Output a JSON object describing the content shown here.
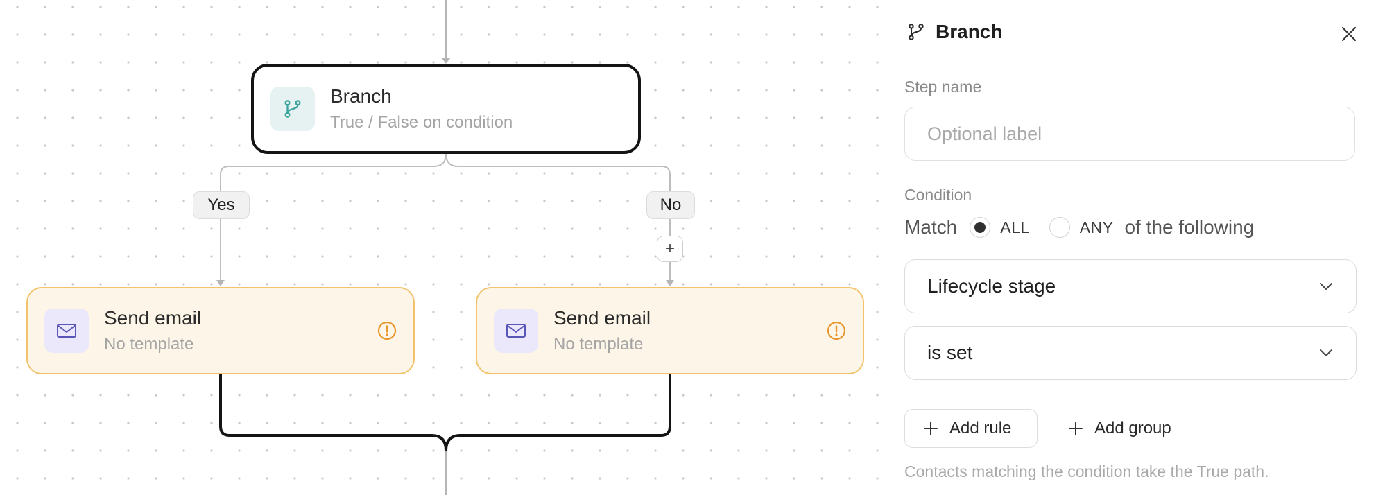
{
  "canvas": {
    "branch_node": {
      "title": "Branch",
      "subtitle": "True / False on condition",
      "icon": "branch-icon"
    },
    "edge_labels": {
      "yes": "Yes",
      "no": "No"
    },
    "add_step_label": "+",
    "email_nodes": [
      {
        "title": "Send email",
        "subtitle": "No template",
        "icon": "mail-icon",
        "status_icon": "warning-icon"
      },
      {
        "title": "Send email",
        "subtitle": "No template",
        "icon": "mail-icon",
        "status_icon": "warning-icon"
      }
    ]
  },
  "panel": {
    "title": "Branch",
    "title_icon": "branch-icon",
    "close_icon": "close-icon",
    "step_name": {
      "label": "Step name",
      "placeholder": "Optional label",
      "value": ""
    },
    "condition": {
      "label": "Condition",
      "match_prefix": "Match",
      "options": [
        "ALL",
        "ANY"
      ],
      "selected": "ALL",
      "match_suffix": "of the following",
      "field_select": "Lifecycle stage",
      "operator_select": "is set"
    },
    "add_rule_label": "Add rule",
    "add_group_label": "Add group",
    "hint": "Contacts matching the condition take the True path."
  },
  "colors": {
    "node_border": "#141414",
    "email_node_bg": "#fdf6e8",
    "email_node_border": "#f1c36c",
    "warning": "#e8972e",
    "branch_icon": "#3aa39b",
    "mail_icon": "#5a56b8"
  }
}
